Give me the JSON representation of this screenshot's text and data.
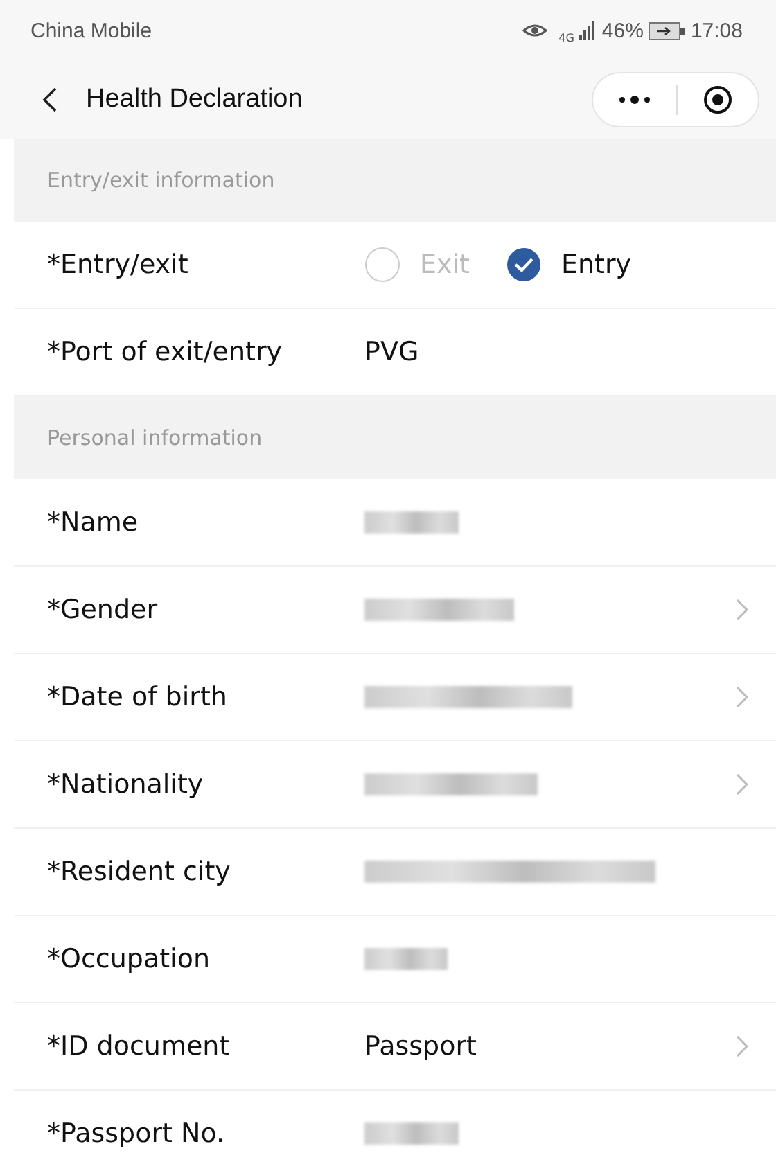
{
  "status_bar": {
    "carrier": "China Mobile",
    "network": "4G",
    "battery": "46%",
    "time": "17:08"
  },
  "nav": {
    "title": "Health Declaration"
  },
  "sections": [
    {
      "title": "Entry/exit information",
      "rows": [
        {
          "kind": "radio",
          "label": "*Entry/exit",
          "options": [
            {
              "label": "Exit",
              "selected": false
            },
            {
              "label": "Entry",
              "selected": true
            }
          ]
        },
        {
          "kind": "text",
          "label": "*Port of exit/entry",
          "value": "PVG",
          "chevron": false
        }
      ]
    },
    {
      "title": "Personal information",
      "rows": [
        {
          "kind": "redacted",
          "label": "*Name",
          "chevron": false
        },
        {
          "kind": "redacted",
          "label": "*Gender",
          "chevron": true
        },
        {
          "kind": "redacted",
          "label": "*Date of birth",
          "chevron": true
        },
        {
          "kind": "redacted",
          "label": "*Nationality",
          "chevron": true
        },
        {
          "kind": "redacted",
          "label": "*Resident city",
          "chevron": false
        },
        {
          "kind": "redacted",
          "label": "*Occupation",
          "chevron": false
        },
        {
          "kind": "text",
          "label": "*ID document",
          "value": "Passport",
          "chevron": true
        },
        {
          "kind": "redacted",
          "label": "*Passport No.",
          "chevron": false
        }
      ]
    }
  ]
}
